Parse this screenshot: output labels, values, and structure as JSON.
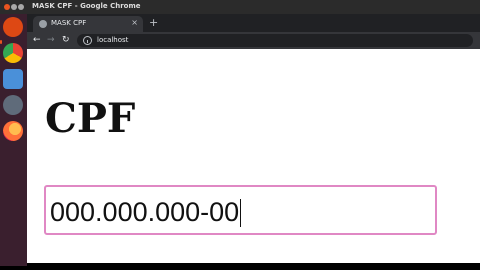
{
  "window": {
    "title": "MASK CPF - Google Chrome"
  },
  "browser": {
    "tab": {
      "title": "MASK CPF",
      "close_glyph": "×"
    },
    "new_tab_glyph": "+",
    "nav": {
      "back": "←",
      "forward": "→",
      "reload": "↻"
    },
    "address": "localhost"
  },
  "dock": {
    "items": [
      {
        "name": "ubuntu-software-icon",
        "color": "#dd4814"
      },
      {
        "name": "chrome-icon",
        "color": "#34a853"
      },
      {
        "name": "files-icon",
        "color": "#4a90d9"
      },
      {
        "name": "chromium-icon",
        "color": "#5f6b7a"
      },
      {
        "name": "firefox-icon",
        "color": "#ff7139"
      }
    ]
  },
  "main": {
    "heading": "CPF",
    "cpf_input": {
      "value": "000.000.000-00",
      "border_color": "#e088c4"
    }
  }
}
